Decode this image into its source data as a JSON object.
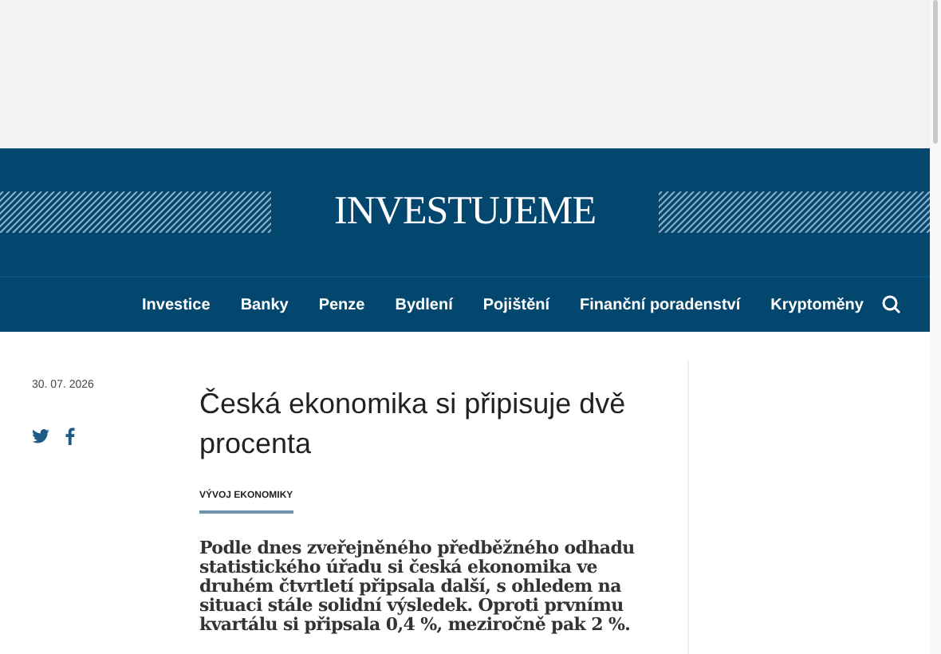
{
  "logo": "INVESTUJEME",
  "nav": [
    {
      "label": "Investice"
    },
    {
      "label": "Banky"
    },
    {
      "label": "Penze"
    },
    {
      "label": "Bydlení"
    },
    {
      "label": "Pojištění"
    },
    {
      "label": "Finanční poradenství"
    },
    {
      "label": "Kryptoměny"
    }
  ],
  "article": {
    "date": "30. 07. 2026",
    "title": "Česká ekonomika si připisuje dvě procenta",
    "category": "VÝVOJ EKONOMIKY",
    "lede": "Podle dnes zveřejněného předběžného odhadu statistického úřadu si česká ekonomika ve druhém čtvrtletí připsala další, s ohledem na situaci stále solidní výsledek. Oproti prvnímu kvartálu si připsala 0,4 %, meziročně pak 2 %."
  }
}
